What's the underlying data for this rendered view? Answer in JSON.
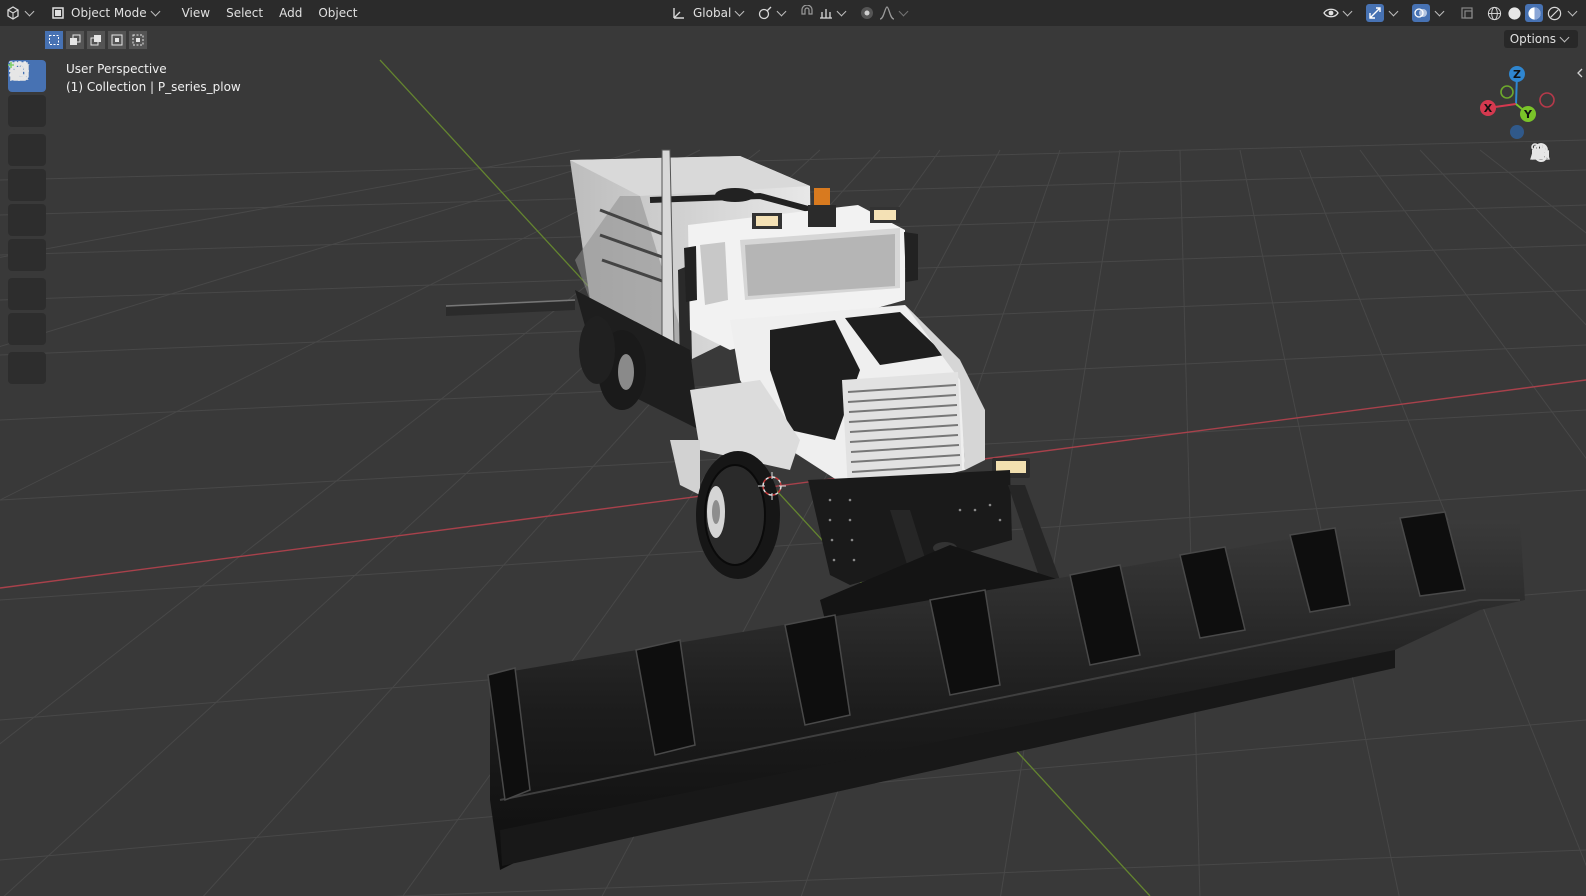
{
  "header": {
    "mode_label": "Object Mode",
    "menus": [
      "View",
      "Select",
      "Add",
      "Object"
    ],
    "orientation_label": "Global"
  },
  "toolsettings": {
    "options_label": "Options"
  },
  "viewport": {
    "view_name": "User Perspective",
    "collection_info": "(1) Collection | P_series_plow"
  },
  "gizmo": {
    "x_label": "X",
    "y_label": "Y",
    "z_label": "Z",
    "x_color": "#d4394f",
    "y_color": "#7ac429",
    "z_color": "#2f86d0"
  },
  "colors": {
    "accent": "#4772b3",
    "header_bg": "#2b2b2b",
    "viewport_bg": "#393939",
    "grid_line": "#474747",
    "x_axis": "#b3414b",
    "y_axis": "#6a8d2e"
  }
}
